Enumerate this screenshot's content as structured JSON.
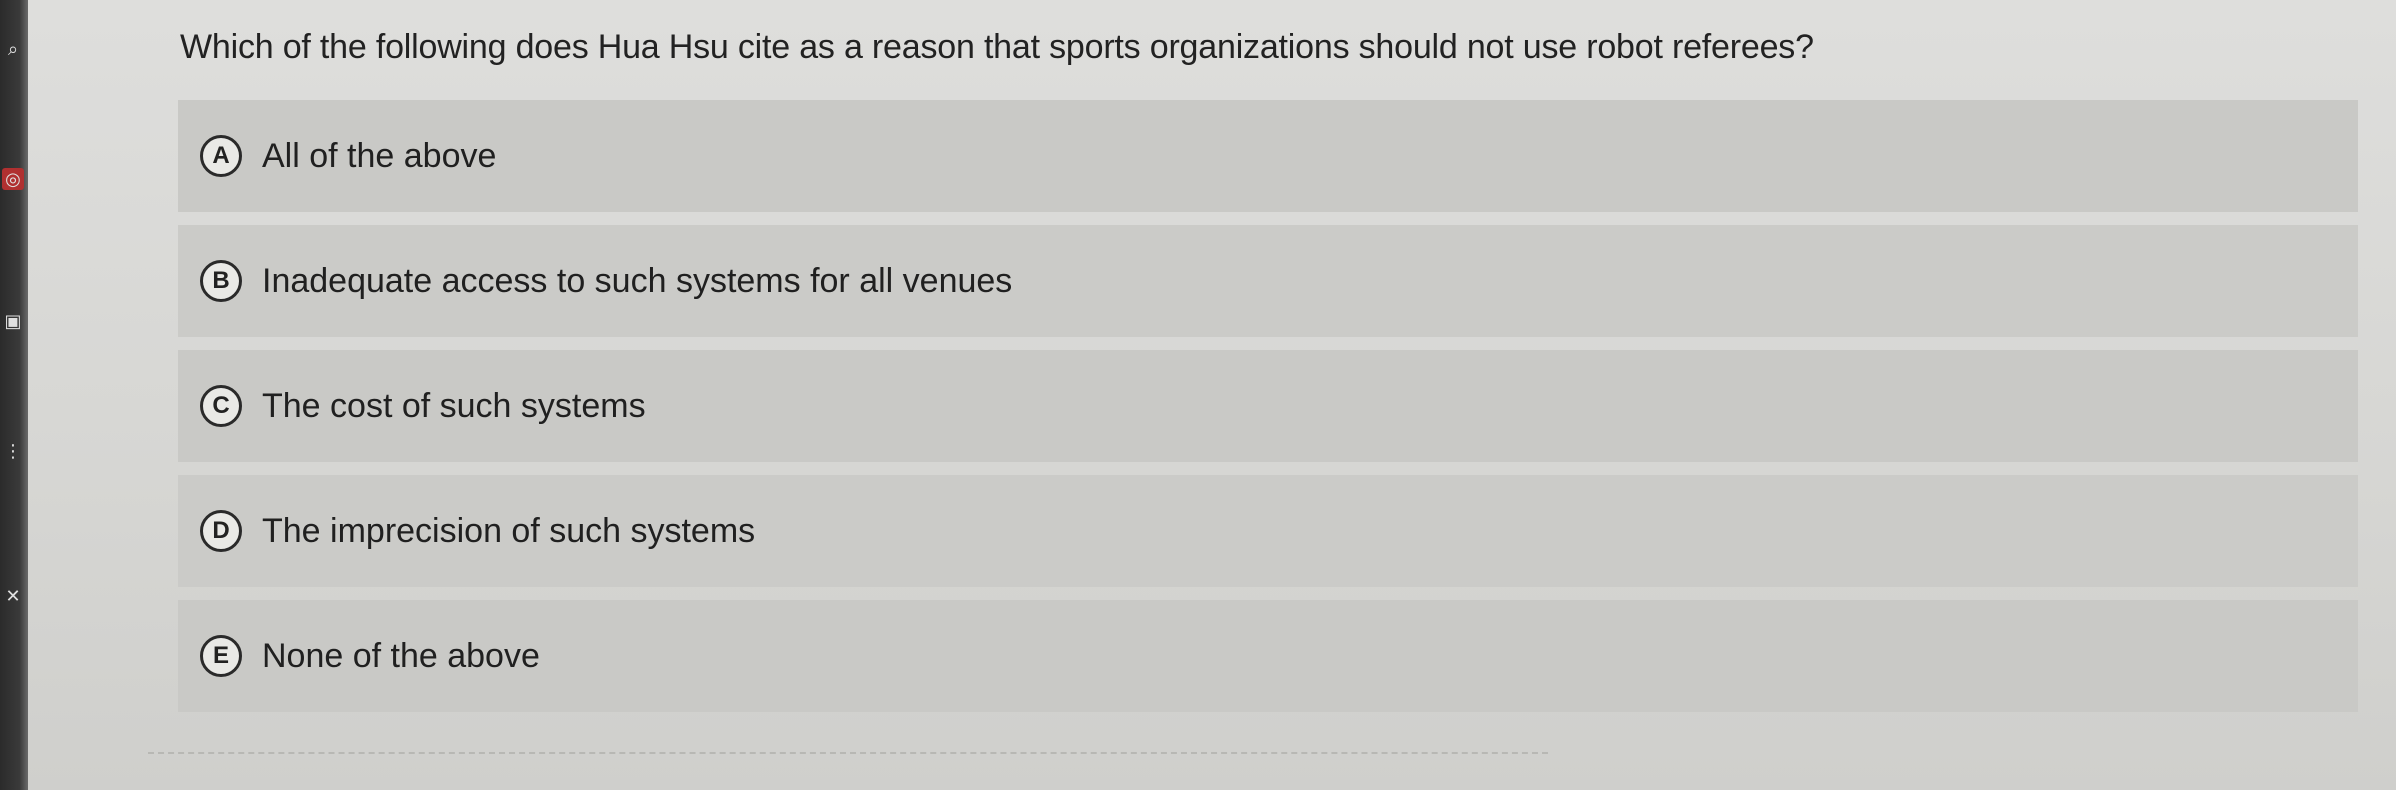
{
  "question": "Which of the following does Hua Hsu cite as a reason that sports organizations should not use robot referees?",
  "options": [
    {
      "letter": "A",
      "text": "All of the above"
    },
    {
      "letter": "B",
      "text": "Inadequate access to such systems for all venues"
    },
    {
      "letter": "C",
      "text": "The cost of such systems"
    },
    {
      "letter": "D",
      "text": "The imprecision of such systems"
    },
    {
      "letter": "E",
      "text": "None of the above"
    }
  ],
  "sidebar": {
    "icons": [
      "search-icon",
      "globe-icon",
      "box-icon",
      "dots-icon",
      "close-icon"
    ]
  }
}
